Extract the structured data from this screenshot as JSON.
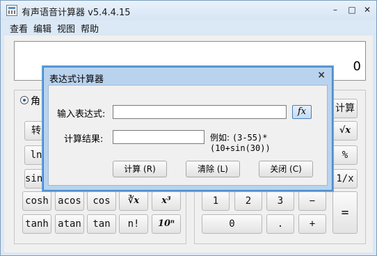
{
  "window": {
    "title": "有声语音计算器 v5.4.4.15",
    "controls": [
      "–",
      "□",
      "✕"
    ]
  },
  "menu": [
    "查看",
    "编辑",
    "视图",
    "帮助"
  ],
  "display": {
    "value": "0"
  },
  "left_panel": {
    "radio_label": "角",
    "keys": [
      [
        "转"
      ],
      [
        "ln"
      ],
      [
        "sinh"
      ],
      [
        "cosh",
        "acos",
        "cos",
        "∛x",
        "x³"
      ],
      [
        "tanh",
        "atan",
        "tan",
        "n!",
        "10ⁿ"
      ]
    ]
  },
  "right_panel": {
    "top_label": "计算",
    "keys_right_col": [
      "√x",
      "%",
      "1/x",
      "="
    ],
    "keys_row1": [
      "1",
      "2",
      "3",
      "−"
    ],
    "keys_row2": [
      "0",
      ".",
      "+"
    ]
  },
  "dialog": {
    "title": "表达式计算器",
    "close": "×",
    "expr_label": "输入表达式:",
    "expr_value": "",
    "fx_label": "fx",
    "result_label": "计算结果:",
    "result_value": "",
    "example_prefix": "例如:",
    "example_expr": "(3-55)*(10+sin(30))",
    "buttons": {
      "calc": "计算 (R)",
      "clear": "清除 (L)",
      "close": "关闭 (C)"
    }
  }
}
